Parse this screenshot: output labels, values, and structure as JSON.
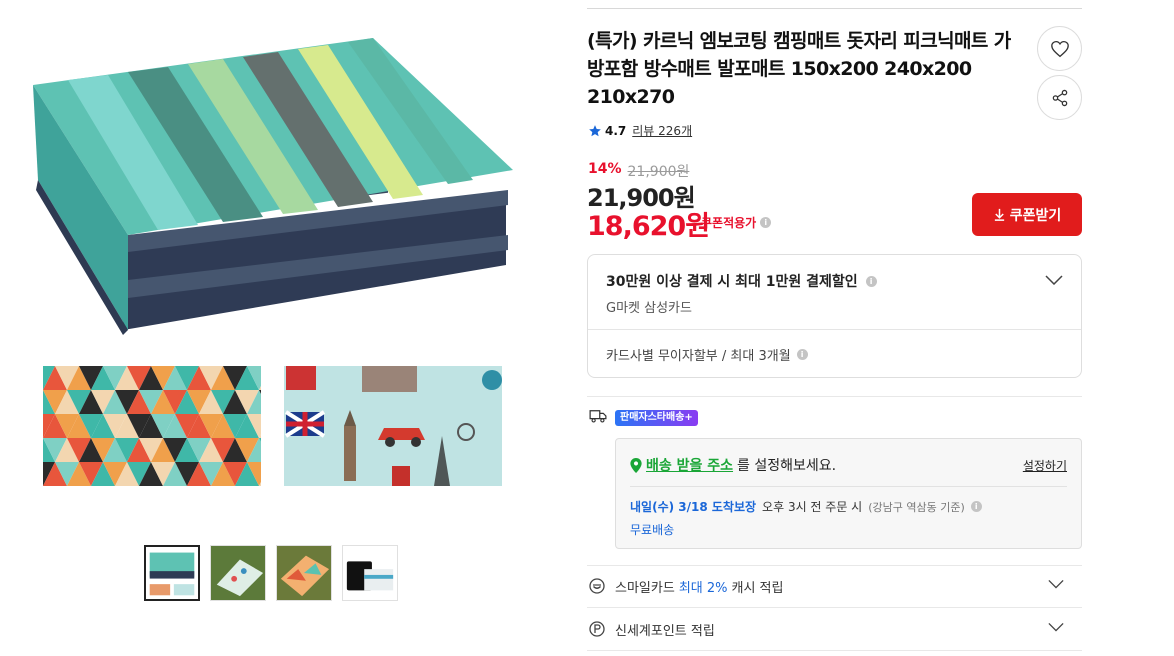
{
  "product": {
    "title": "(특가) 카르닉 엠보코팅 캠핑매트 돗자리 피크닉매트 가방포함 방수매트 발포매트 150x200 240x200 210x270",
    "rating": "4.7",
    "review_label": "리뷰 226개",
    "discount_rate": "14%",
    "original_price": "21,900원",
    "price": "21,900원",
    "coupon_price": "18,620원",
    "coupon_note": "쿠폰적용가",
    "coupon_button": "쿠폰받기"
  },
  "benefit": {
    "headline": "30만원 이상 결제 시 최대 1만원 결제할인",
    "card": "G마켓 삼성카드",
    "installment": "카드사별 무이자할부 / 최대 3개월"
  },
  "delivery": {
    "badge": "판매자스타배송+",
    "address_link": "배송 받을 주소",
    "address_text": "를 설정해보세요.",
    "set_link": "설정하기",
    "arrival_date": "내일(수) 3/18 도착보장",
    "arrival_time": "오후 3시 전 주문 시",
    "arrival_area": "(강남구 역삼동 기준)",
    "free_shipping": "무료배송"
  },
  "rewards": {
    "smile_prefix": "스마일카드",
    "smile_highlight": "최대 2%",
    "smile_suffix": "캐시 적립",
    "shinsegae": "신세계포인트 적립"
  },
  "icons": {
    "heart": "heart-icon",
    "share": "share-icon",
    "star": "star-icon",
    "truck": "truck-icon",
    "pin": "location-pin-icon",
    "chevron": "chevron-down-icon"
  },
  "colors": {
    "accent_red": "#e11c1c",
    "link_blue": "#1b67d8",
    "link_green": "#1aa637"
  }
}
